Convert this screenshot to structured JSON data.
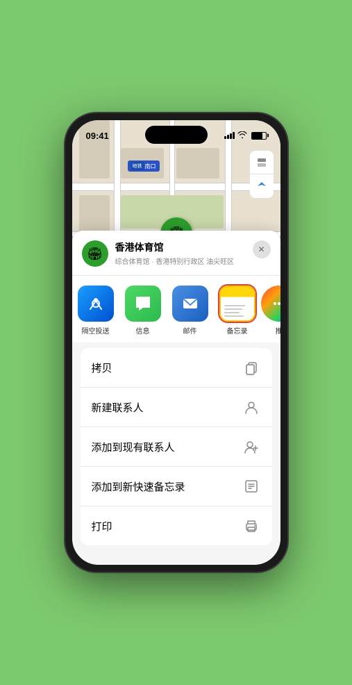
{
  "statusBar": {
    "time": "09:41",
    "locationIcon": "▶"
  },
  "map": {
    "subwayLabel": "南口",
    "locationPinLabel": "香港体育馆",
    "mapControlLayer": "⊞",
    "mapControlCompass": "➤"
  },
  "venueHeader": {
    "name": "香港体育馆",
    "subtitle": "综合体育馆 · 香港特别行政区 油尖旺区",
    "closeLabel": "✕"
  },
  "shareItems": [
    {
      "id": "airdrop",
      "label": "隔空投送",
      "iconType": "airdrop"
    },
    {
      "id": "message",
      "label": "信息",
      "iconType": "message"
    },
    {
      "id": "mail",
      "label": "邮件",
      "iconType": "mail"
    },
    {
      "id": "notes",
      "label": "备忘录",
      "iconType": "notes",
      "highlighted": true
    },
    {
      "id": "more",
      "label": "推",
      "iconType": "more"
    }
  ],
  "actionItems": [
    {
      "id": "copy",
      "label": "拷贝",
      "icon": "copy"
    },
    {
      "id": "add-contact",
      "label": "新建联系人",
      "icon": "person"
    },
    {
      "id": "add-existing",
      "label": "添加到现有联系人",
      "icon": "person-add"
    },
    {
      "id": "add-notes",
      "label": "添加到新快速备忘录",
      "icon": "note"
    },
    {
      "id": "print",
      "label": "打印",
      "icon": "print"
    }
  ]
}
